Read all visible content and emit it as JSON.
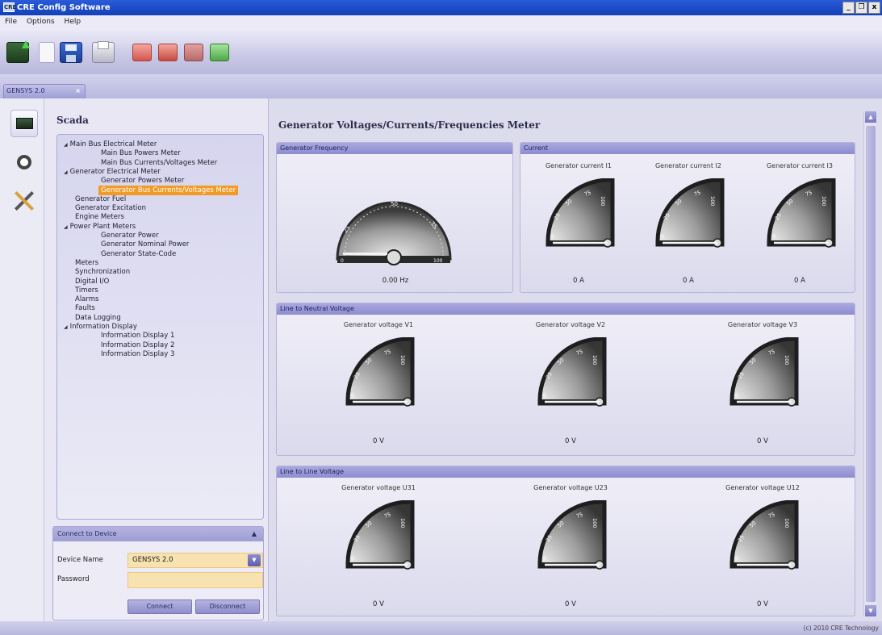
{
  "window": {
    "title": "CRE Config Software",
    "icon_text": "CRE",
    "controls": [
      "_",
      "❐",
      "x"
    ]
  },
  "menu": {
    "items": [
      "File",
      "Options",
      "Help"
    ]
  },
  "tabs": [
    {
      "label": "GENSYS 2.0"
    }
  ],
  "sidebar": {
    "title": "Scada",
    "tree": [
      {
        "label": "Main Bus Electrical Meter",
        "level": 0,
        "expanded": true
      },
      {
        "label": "Main Bus Powers Meter",
        "level": 2
      },
      {
        "label": "Main Bus Currents/Voltages Meter",
        "level": 2
      },
      {
        "label": "Generator Electrical Meter",
        "level": 0,
        "expanded": true
      },
      {
        "label": "Generator Powers Meter",
        "level": 2
      },
      {
        "label": "Generator Bus Currents/Voltages Meter",
        "level": 2,
        "selected": true
      },
      {
        "label": "Generator Fuel",
        "level": 1
      },
      {
        "label": "Generator Excitation",
        "level": 1
      },
      {
        "label": "Engine Meters",
        "level": 1
      },
      {
        "label": "Power Plant Meters",
        "level": 0,
        "expanded": true
      },
      {
        "label": "Generator Power",
        "level": 2
      },
      {
        "label": "Generator Nominal Power",
        "level": 2
      },
      {
        "label": "Generator State-Code",
        "level": 2
      },
      {
        "label": "Meters",
        "level": 1
      },
      {
        "label": "Synchronization",
        "level": 1
      },
      {
        "label": "Digital I/O",
        "level": 1
      },
      {
        "label": "Timers",
        "level": 1
      },
      {
        "label": "Alarms",
        "level": 1
      },
      {
        "label": "Faults",
        "level": 1
      },
      {
        "label": "Data Logging",
        "level": 1
      },
      {
        "label": "Information Display",
        "level": 0,
        "expanded": true
      },
      {
        "label": "Information Display 1",
        "level": 2
      },
      {
        "label": "Information Display 2",
        "level": 2
      },
      {
        "label": "Information Display 3",
        "level": 2
      }
    ],
    "connect": {
      "header": "Connect to Device",
      "device_label": "Device Name",
      "device_value": "GENSYS 2.0",
      "password_label": "Password",
      "password_value": "",
      "connect_label": "Connect",
      "disconnect_label": "Disconnect"
    }
  },
  "main": {
    "title": "Generator Voltages/Currents/Frequencies Meter",
    "frequency": {
      "header": "Generator Frequency",
      "value": "0.00 Hz",
      "gauge_min": "0",
      "gauge_max": "100",
      "ticks": [
        "25",
        "50",
        "75"
      ],
      "level": 0
    },
    "current": {
      "header": "Current",
      "meters": [
        {
          "label": "Generator current I1",
          "value": "0 A",
          "level": 0
        },
        {
          "label": "Generator current I2",
          "value": "0 A",
          "level": 0
        },
        {
          "label": "Generator current I3",
          "value": "0 A",
          "level": 0
        }
      ]
    },
    "line_neutral": {
      "header": "Line to Neutral Voltage",
      "meters": [
        {
          "label": "Generator voltage V1",
          "value": "0 V",
          "level": 0
        },
        {
          "label": "Generator voltage V2",
          "value": "0 V",
          "level": 0
        },
        {
          "label": "Generator voltage V3",
          "value": "0 V",
          "level": 0
        }
      ]
    },
    "line_line": {
      "header": "Line to Line Voltage",
      "meters": [
        {
          "label": "Generator voltage U31",
          "value": "0 V",
          "level": 0
        },
        {
          "label": "Generator voltage U23",
          "value": "0 V",
          "level": 0
        },
        {
          "label": "Generator voltage U12",
          "value": "0 V",
          "level": 0
        }
      ]
    },
    "quarter_gauge_ticks": [
      "0",
      "25",
      "50",
      "75",
      "100"
    ]
  },
  "status": {
    "copyright": "(c) 2010 CRE Technology"
  },
  "colors": {
    "selection": "#f19a26",
    "header": "#9897d4",
    "title_bar": "#1f4fc8"
  }
}
